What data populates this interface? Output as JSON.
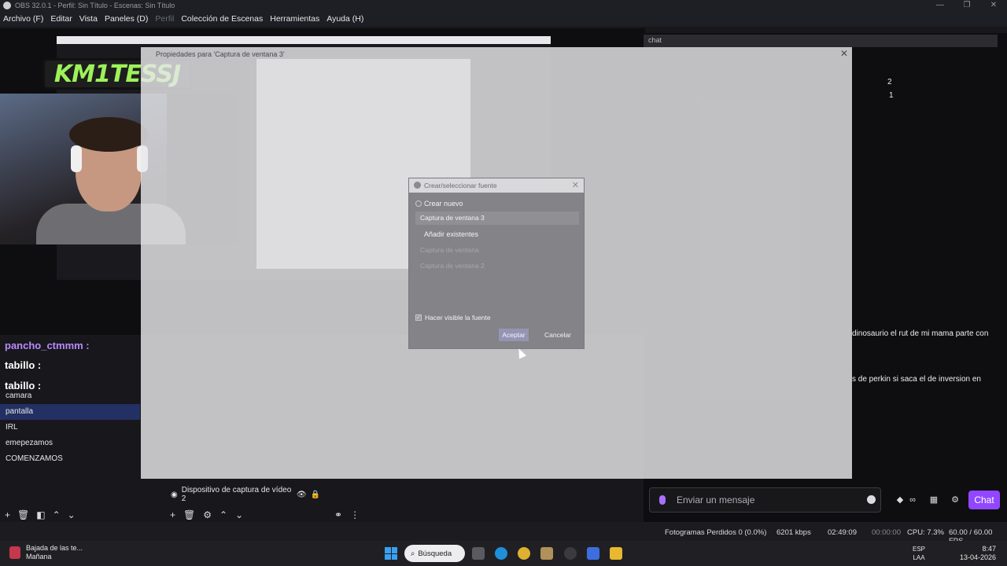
{
  "window": {
    "title": "OBS 32.0.1 - Perfil: Sin Título - Escenas: Sin Título",
    "controls": [
      "—",
      "❐",
      "✕"
    ]
  },
  "menubar": {
    "items": [
      {
        "label": "Archivo (F)"
      },
      {
        "label": "Editar"
      },
      {
        "label": "Vista"
      },
      {
        "label": "Paneles (D)"
      },
      {
        "label": "Perfil",
        "disabled": true
      },
      {
        "label": "Colección de Escenas"
      },
      {
        "label": "Herramientas"
      },
      {
        "label": "Ayuda (H)"
      }
    ]
  },
  "overlay": {
    "logo_text": "KM1TESSJ",
    "chat_names": [
      "pancho_ctmmm :",
      "tabillo :",
      "tabillo :"
    ]
  },
  "properties_dialog": {
    "title": "Propiedades para 'Captura de ventana 3'",
    "close": "✕"
  },
  "source_dialog": {
    "title": "Crear/seleccionar fuente",
    "close": "✕",
    "option_new": "Crear nuevo",
    "new_name_value": "Captura de ventana 3",
    "option_existing": "Añadir existentes",
    "existing_items": [
      "Captura de ventana",
      "Captura de ventana 2"
    ],
    "visible_checkbox": "Hacer visible la fuente",
    "ok_button": "Aceptar",
    "cancel_button": "Cancelar"
  },
  "scenes": {
    "items": [
      "camara",
      "pantalla",
      "IRL",
      "emepezamos",
      "COMENZAMOS"
    ],
    "selected": "pantalla"
  },
  "sources": {
    "visible_item": "Dispositivo de captura de vídeo 2"
  },
  "chat": {
    "header": "chat",
    "counts": [
      "2",
      "1"
    ],
    "messages": [
      "dinosaurio el rut de mi mama parte con",
      "s de perkin si saca el de inversion en"
    ],
    "input_placeholder": "Enviar un mensaje",
    "chat_button": "Chat"
  },
  "statusbar": {
    "dropped_frames": "Fotogramas Perdidos 0 (0.0%)",
    "bitrate": "6201 kbps",
    "stream_time": "02:49:09",
    "rec_time": "00:00:00",
    "cpu": "CPU: 7.3%",
    "fps": "60.00 / 60.00 FPS"
  },
  "taskbar": {
    "news_title": "Bajada de las te...",
    "news_sub": "Mañana",
    "search_label": "Búsqueda",
    "lang_top": "ESP",
    "lang_bottom": "LAA",
    "time": "8:47",
    "date": "13-04-2026"
  }
}
